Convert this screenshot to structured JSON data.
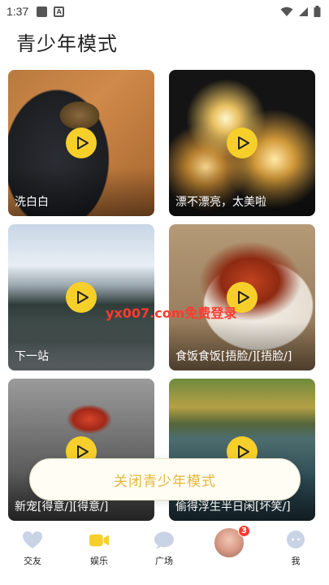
{
  "status_bar": {
    "time": "1:37"
  },
  "page": {
    "title": "青少年模式"
  },
  "videos": [
    {
      "caption": "洗白白"
    },
    {
      "caption": "漂不漂亮，太美啦"
    },
    {
      "caption": "下一站"
    },
    {
      "caption": "食饭食饭[捂脸/][捂脸/]"
    },
    {
      "caption": "新宠[得意/][得意/]"
    },
    {
      "caption": "偷得浮生半日闲[坏笑/]"
    }
  ],
  "watermark": "yx007.com免费登录",
  "close_button": {
    "label": "关闭青少年模式"
  },
  "tabbar": {
    "items": [
      {
        "label": "交友",
        "icon": "heart-icon"
      },
      {
        "label": "娱乐",
        "icon": "video-camera-icon"
      },
      {
        "label": "广场",
        "icon": "chat-bubble-icon"
      },
      {
        "label": "",
        "icon": "avatar",
        "badge": "3"
      },
      {
        "label": "我",
        "icon": "user-icon"
      }
    ]
  },
  "colors": {
    "accent": "#f7cf2b",
    "button_text": "#e1b73a",
    "badge": "#ff3b30"
  }
}
